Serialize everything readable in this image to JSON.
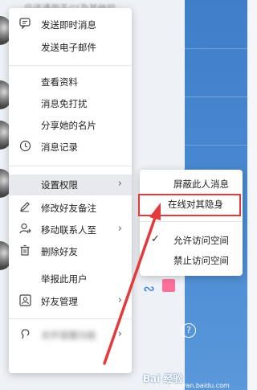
{
  "background": {
    "top_text": "应该通用于/以及其他初"
  },
  "main_menu": {
    "items": [
      {
        "label": "发送即时消息",
        "icon": "chat-bubble-icon"
      },
      {
        "label": "发送电子邮件",
        "icon": ""
      },
      {
        "label": "查看资料",
        "icon": ""
      },
      {
        "label": "消息免打扰",
        "icon": ""
      },
      {
        "label": "分享她的名片",
        "icon": ""
      },
      {
        "label": "消息记录",
        "icon": "clock-icon"
      },
      {
        "label": "设置权限",
        "icon": ""
      },
      {
        "label": "修改好友备注",
        "icon": "pencil-icon"
      },
      {
        "label": "移动联系人至",
        "icon": "person-move-icon"
      },
      {
        "label": "删除好友",
        "icon": "trash-icon"
      },
      {
        "label": "举报此用户",
        "icon": ""
      },
      {
        "label": "好友管理",
        "icon": "person-card-icon"
      },
      {
        "label": "关怀提醒功能",
        "icon": "care-icon"
      }
    ],
    "arrow_glyph": "›"
  },
  "sub_menu": {
    "items": [
      {
        "label": "屏蔽此人消息"
      },
      {
        "label": "在线对其隐身"
      },
      {
        "label": "允许访问空间",
        "checked": true
      },
      {
        "label": "禁止访问空间"
      }
    ],
    "check_glyph": "✓"
  },
  "help_glyph": "?",
  "watermark": {
    "brand": "Bai 经验",
    "url": "jingyan.baidu.com"
  },
  "colors": {
    "highlight_box": "#e23b3b",
    "annotation_arrow": "#e23b3b",
    "hover_row": "#e7e9ec",
    "side_panel": "#4a8ad2"
  }
}
